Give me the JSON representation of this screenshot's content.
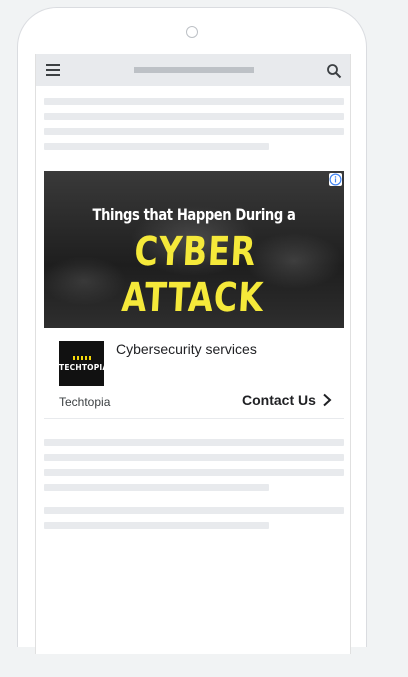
{
  "browser": {
    "menu_icon": "hamburger-menu-icon",
    "search_icon": "magnifier-search-icon"
  },
  "ad": {
    "image_text_line_1": "Things that Happen During a",
    "image_text_line_2": "CYBER ATTACK",
    "image_text_line_2_color": "#f5e93a",
    "info_icon": "info-circle-icon",
    "logo_text": "TECHTOPIA",
    "title": "Cybersecurity services",
    "advertiser": "Techtopia",
    "cta_label": "Contact Us",
    "cta_icon": "chevron-right-icon"
  },
  "colors": {
    "page_background": "#f1f3f4",
    "placeholder": "#e8eaed",
    "topbar": "#e8eaed",
    "info_blue": "#4285f4"
  }
}
